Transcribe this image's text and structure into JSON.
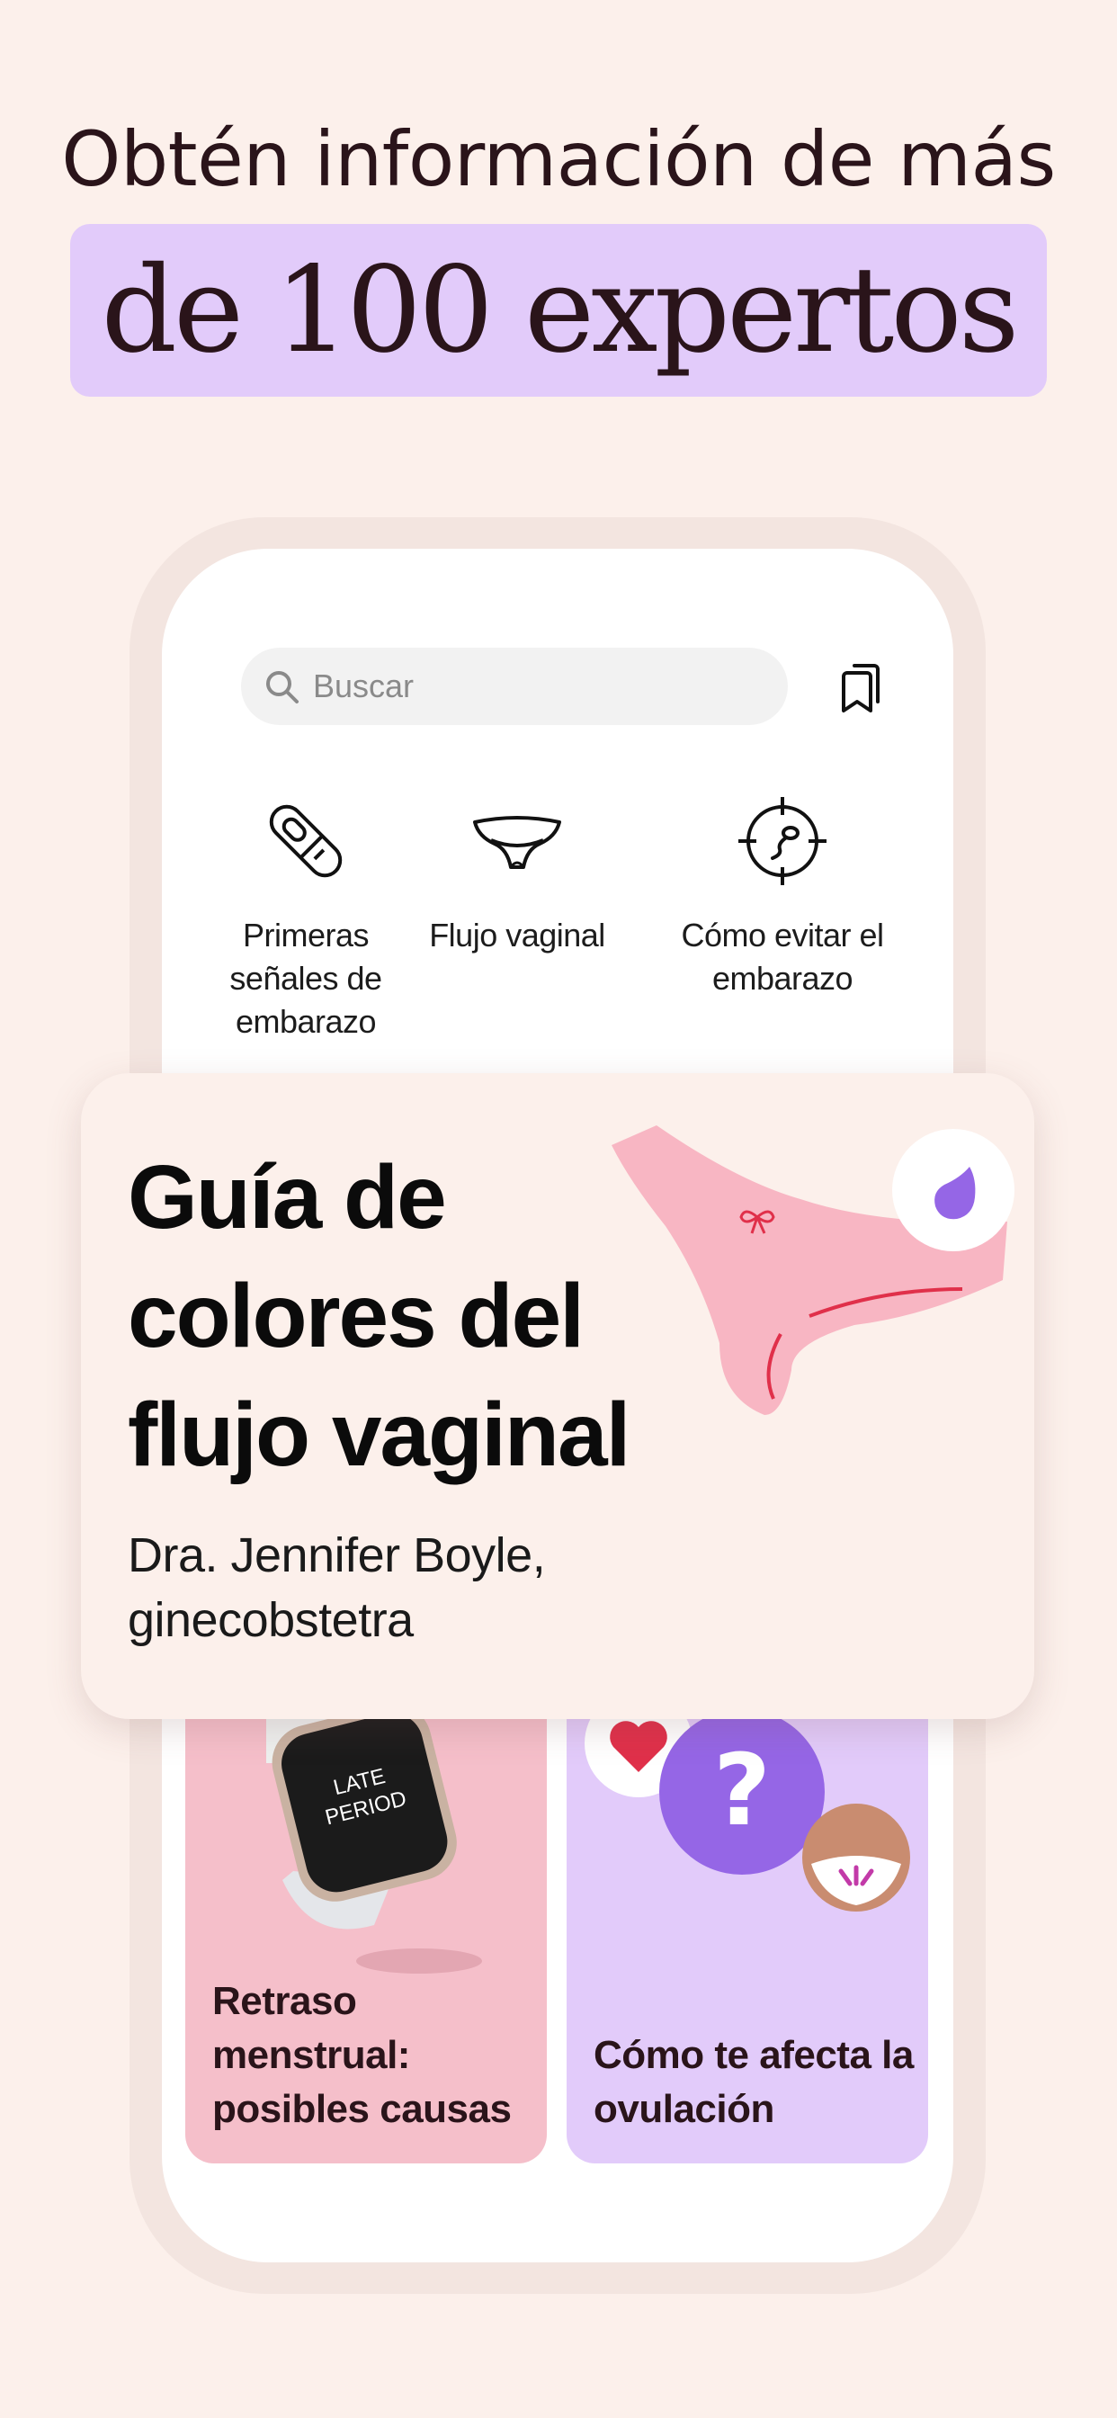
{
  "headline": {
    "line1": "Obtén información de más",
    "line2": "de 100 expertos"
  },
  "colors": {
    "background": "#fcf0eb",
    "highlight": "#e2cbfa",
    "card_pink": "#f5bfca",
    "card_purple": "#e2cbfa",
    "accent_purple": "#9566e6",
    "accent_red": "#e0304a"
  },
  "phone": {
    "search": {
      "placeholder": "Buscar",
      "icon": "search-icon"
    },
    "bookmark_icon": "bookmark-icon",
    "categories": [
      {
        "label": "Primeras señales de embarazo",
        "icon": "pregnancy-test-icon"
      },
      {
        "label": "Flujo vaginal",
        "icon": "underwear-icon"
      },
      {
        "label": "Cómo evitar el embarazo",
        "icon": "target-sperm-icon"
      }
    ],
    "cards": [
      {
        "label": "Retraso menstrual: posibles causas",
        "image_text": "LATE PERIOD"
      },
      {
        "label": "Cómo te afecta la ovulación"
      }
    ]
  },
  "feature": {
    "title": "Guía de colores del flujo vaginal",
    "author": "Dra. Jennifer Boyle, ginecobstetra"
  }
}
